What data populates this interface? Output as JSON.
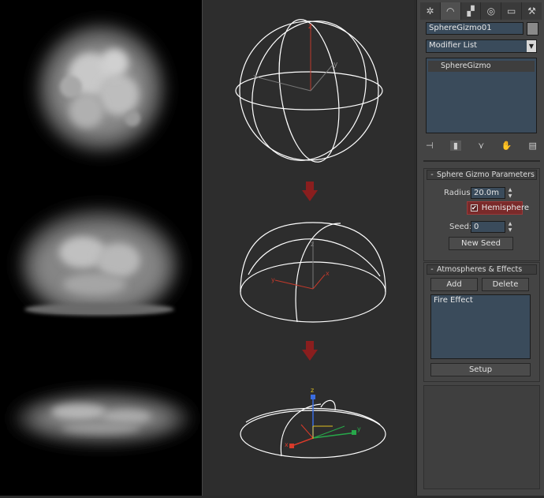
{
  "object_name": "SphereGizmo01",
  "modifier_list": {
    "selected": "Modifier List"
  },
  "modifier_stack": [
    "SphereGizmo"
  ],
  "tabs": [
    "create-icon",
    "modify-icon",
    "hierarchy-icon",
    "motion-icon",
    "display-icon",
    "utilities-icon"
  ],
  "sphere_gizmo_params": {
    "title": "Sphere Gizmo Parameters",
    "radius_label": "Radius:",
    "radius_value": "20.0m",
    "hemisphere_label": "Hemisphere",
    "hemisphere_checked": true,
    "seed_label": "Seed:",
    "seed_value": "0",
    "new_seed_label": "New Seed"
  },
  "atmospheres": {
    "title": "Atmospheres & Effects",
    "add_label": "Add",
    "delete_label": "Delete",
    "effects": [
      "Fire Effect"
    ],
    "setup_label": "Setup"
  },
  "axis_labels": {
    "x": "x",
    "y": "y",
    "z": "z"
  },
  "colors": {
    "panel_bg": "#444444",
    "field_bg": "#3a4b5b",
    "hemisphere_highlight": "#7a2a2a",
    "arrow_red": "#8a1e1e",
    "wire": "#ffffff"
  }
}
